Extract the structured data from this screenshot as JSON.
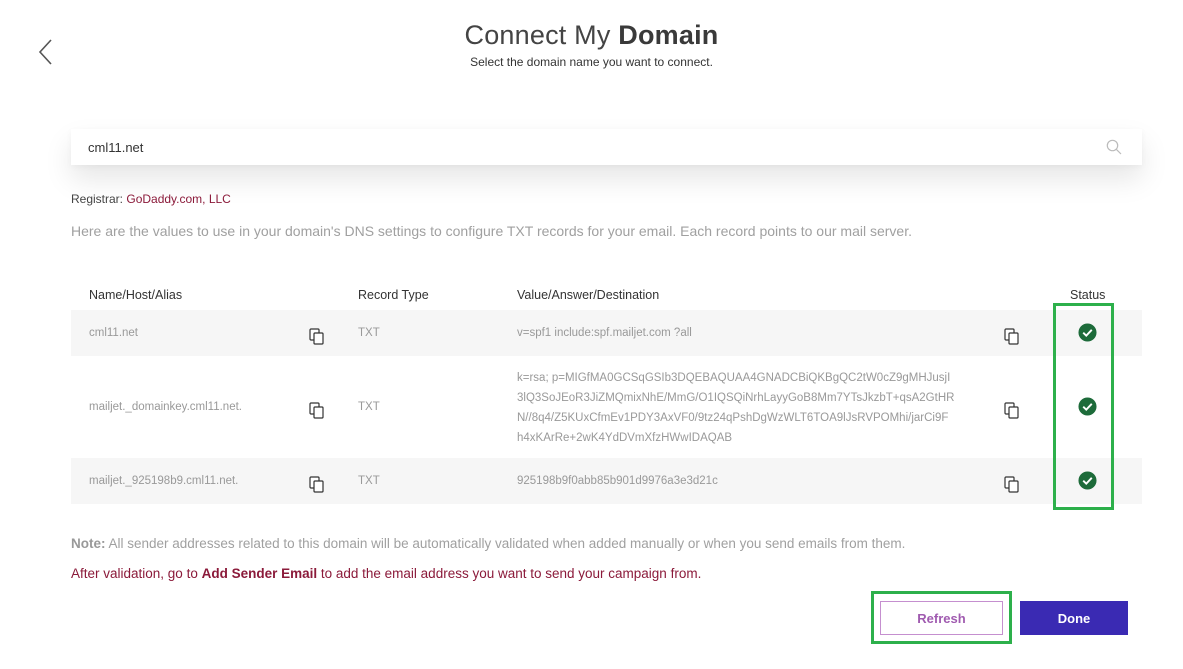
{
  "header": {
    "title_light": "Connect My",
    "title_bold": "Domain",
    "subtitle": "Select the domain name you want to connect."
  },
  "search": {
    "value": "cml11.net"
  },
  "registrar": {
    "label": "Registrar:",
    "name": "GoDaddy.com, LLC"
  },
  "info_text": "Here are the values to use in your domain's DNS settings to configure TXT records for your email. Each record points to our mail server.",
  "table": {
    "headers": {
      "name": "Name/Host/Alias",
      "type": "Record Type",
      "value": "Value/Answer/Destination",
      "status": "Status"
    },
    "rows": [
      {
        "name": "cml11.net",
        "type": "TXT",
        "value": "v=spf1 include:spf.mailjet.com ?all",
        "status": "verified"
      },
      {
        "name": "mailjet._domainkey.cml11.net.",
        "type": "TXT",
        "value_lines": [
          "k=rsa; p=MIGfMA0GCSqGSIb3DQEBAQUAA4GNADCBiQKBgQC2tW0cZ9gMHJusjI",
          "3lQ3SoJEoR3JiZMQmixNhE/MmG/O1IQSQiNrhLayyGoB8Mm7YTsJkzbT+qsA2GtHR",
          "N//8q4/Z5KUxCfmEv1PDY3AxVF0/9tz24qPshDgWzWLT6TOA9lJsRVPOMhi/jarCi9F",
          "h4xKArRe+2wK4YdDVmXfzHWwIDAQAB"
        ],
        "status": "verified"
      },
      {
        "name": "mailjet._925198b9.cml11.net.",
        "type": "TXT",
        "value": "925198b9f0abb85b901d9976a3e3d21c",
        "status": "verified"
      }
    ]
  },
  "note": {
    "label": "Note:",
    "text": " All sender addresses related to this domain will be automatically validated when added manually or when you send emails from them."
  },
  "after": {
    "prefix": "After validation, go to ",
    "link": "Add Sender Email",
    "suffix": " to add the email address you want to send your campaign from."
  },
  "buttons": {
    "refresh": "Refresh",
    "done": "Done"
  },
  "colors": {
    "accent_purple": "#3a2ab3",
    "link_red": "#8b1a3a",
    "status_green": "#1d6b3a",
    "highlight_green": "#2db04b"
  },
  "icons": {
    "back": "chevron-left-icon",
    "search": "search-icon",
    "copy": "copy-icon",
    "status": "check-circle-icon"
  }
}
